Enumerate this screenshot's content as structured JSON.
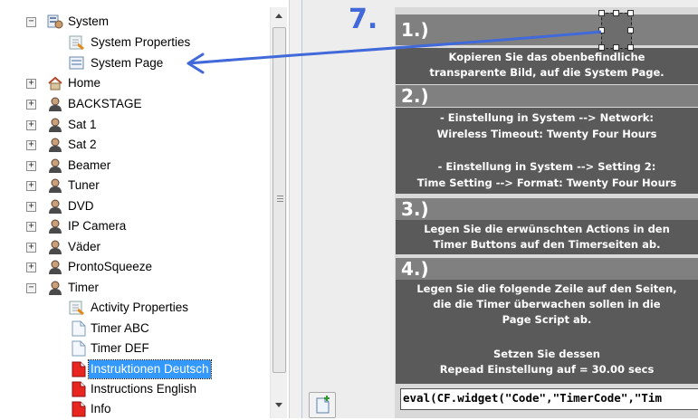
{
  "tree": {
    "items": [
      {
        "label": "System",
        "expanded": true,
        "icon": "system-icon"
      },
      {
        "label": "System Properties",
        "icon": "properties-icon"
      },
      {
        "label": "System Page",
        "icon": "page-icon"
      },
      {
        "label": "Home",
        "expanded": false,
        "icon": "home-icon"
      },
      {
        "label": "BACKSTAGE",
        "expanded": false,
        "icon": "activity-icon"
      },
      {
        "label": "Sat 1",
        "expanded": false,
        "icon": "activity-icon"
      },
      {
        "label": "Sat 2",
        "expanded": false,
        "icon": "activity-icon"
      },
      {
        "label": "Beamer",
        "expanded": false,
        "icon": "activity-icon"
      },
      {
        "label": "Tuner",
        "expanded": false,
        "icon": "activity-icon"
      },
      {
        "label": "DVD",
        "expanded": false,
        "icon": "activity-icon"
      },
      {
        "label": "IP Camera",
        "expanded": false,
        "icon": "activity-icon"
      },
      {
        "label": "Väder",
        "expanded": false,
        "icon": "activity-icon"
      },
      {
        "label": "ProntoSqueeze",
        "expanded": false,
        "icon": "activity-icon"
      },
      {
        "label": "Timer",
        "expanded": true,
        "icon": "activity-icon"
      },
      {
        "label": "Activity Properties",
        "icon": "properties-icon"
      },
      {
        "label": "Timer ABC",
        "icon": "page-icon"
      },
      {
        "label": "Timer DEF",
        "icon": "page-icon"
      },
      {
        "label": "Instruktionen Deutsch",
        "icon": "red-page-icon",
        "selected": true
      },
      {
        "label": "Instructions English",
        "icon": "red-page-icon"
      },
      {
        "label": "Info",
        "icon": "red-page-icon"
      }
    ]
  },
  "annotation": {
    "step": "7."
  },
  "page": {
    "step1": {
      "num": "1.)",
      "text": [
        "Kopieren Sie das obenbefindliche",
        "transparente Bild, auf die System Page."
      ]
    },
    "step2": {
      "num": "2.)",
      "text": [
        "- Einstellung in System --> Network:",
        "Wireless Timeout: Twenty Four Hours",
        "",
        "- Einstellung in System --> Setting 2:",
        "Time Setting --> Format: Twenty Four Hours"
      ]
    },
    "step3": {
      "num": "3.)",
      "text": [
        "Legen Sie die erwünschten Actions in den",
        "Timer Buttons auf den Timerseiten ab."
      ]
    },
    "step4": {
      "num": "4.)",
      "text": [
        "Legen Sie die folgende Zeile auf den Seiten,",
        "die die Timer überwachen sollen in die",
        "Page Script ab.",
        "",
        "Setzen Sie dessen",
        "Repead Einstellung auf = 30.00 secs"
      ]
    },
    "code": "eval(CF.widget(\"Code\",\"TimerCode\",\"Tim"
  },
  "colors": {
    "accent_arrow": "#4169d9",
    "selection": "#3399ff",
    "block_dark": "#5a5a5a",
    "block_header": "#808080"
  }
}
